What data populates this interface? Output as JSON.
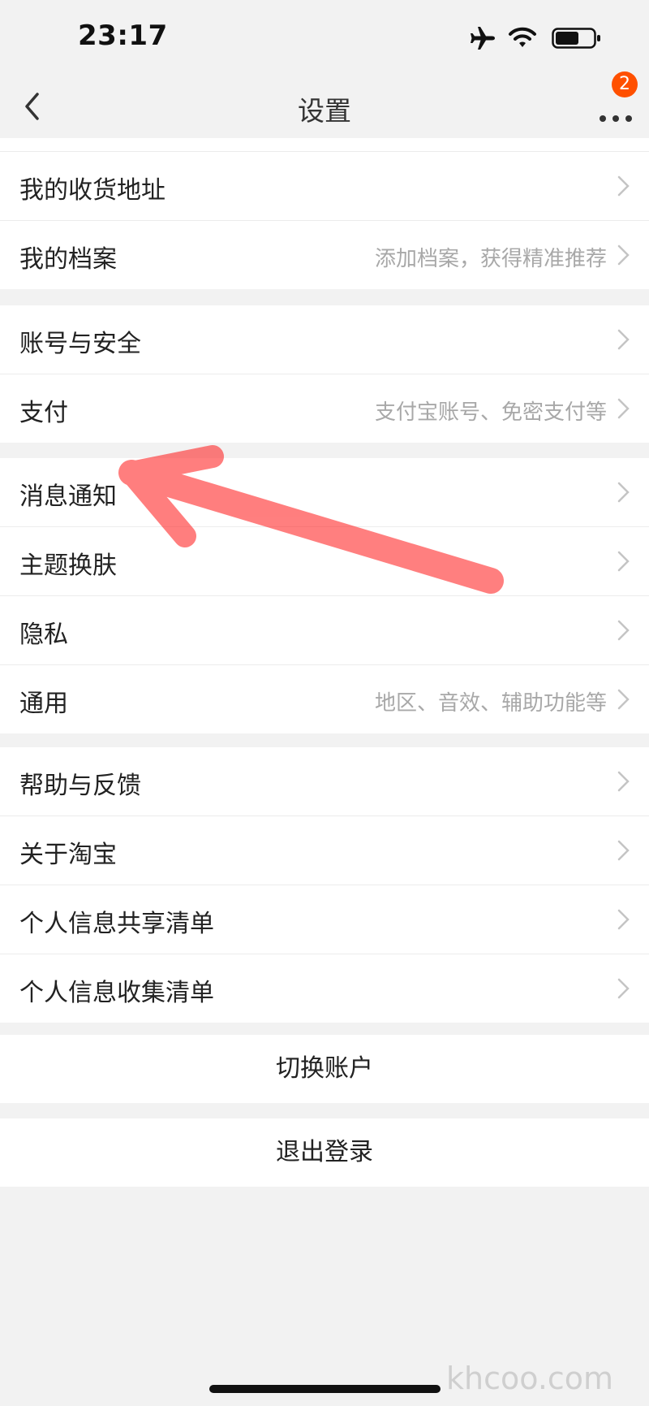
{
  "status_bar": {
    "time": "23:17"
  },
  "nav": {
    "title": "设置",
    "badge_count": "2"
  },
  "groups": [
    {
      "rows": [
        {
          "label": "我的收货地址",
          "hint": ""
        },
        {
          "label": "我的档案",
          "hint": "添加档案，获得精准推荐"
        }
      ]
    },
    {
      "rows": [
        {
          "label": "账号与安全",
          "hint": ""
        },
        {
          "label": "支付",
          "hint": "支付宝账号、免密支付等"
        }
      ]
    },
    {
      "rows": [
        {
          "label": "消息通知",
          "hint": ""
        },
        {
          "label": "主题换肤",
          "hint": ""
        },
        {
          "label": "隐私",
          "hint": ""
        },
        {
          "label": "通用",
          "hint": "地区、音效、辅助功能等"
        }
      ]
    },
    {
      "rows": [
        {
          "label": "帮助与反馈",
          "hint": ""
        },
        {
          "label": "关于淘宝",
          "hint": ""
        },
        {
          "label": "个人信息共享清单",
          "hint": ""
        },
        {
          "label": "个人信息收集清单",
          "hint": ""
        }
      ]
    }
  ],
  "actions": {
    "switch_account": "切换账户",
    "logout": "退出登录"
  },
  "watermark": "khcoo.com",
  "colors": {
    "accent": "#ff5000",
    "annotation_arrow": "#ff2a2a"
  },
  "icons": [
    "back-chevron-icon",
    "more-dots-icon",
    "airplane-icon",
    "wifi-icon",
    "battery-icon",
    "chevron-right-icon"
  ]
}
